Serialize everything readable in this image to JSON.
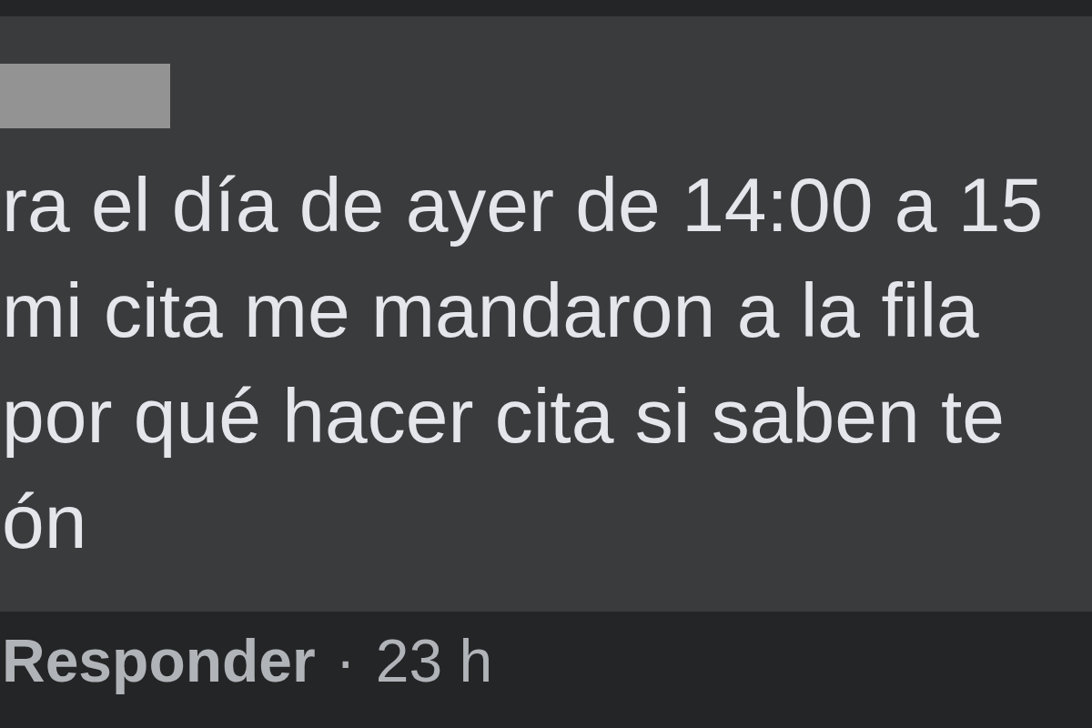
{
  "comment": {
    "author": {
      "redacted": true
    },
    "lines": [
      "ra el día de ayer de 14:00 a 15",
      "mi cita me mandaron a la fila",
      "por qué hacer cita si saben te",
      "ón"
    ]
  },
  "actions": {
    "reply": "Responder",
    "separator": "·",
    "time": "23 h"
  }
}
